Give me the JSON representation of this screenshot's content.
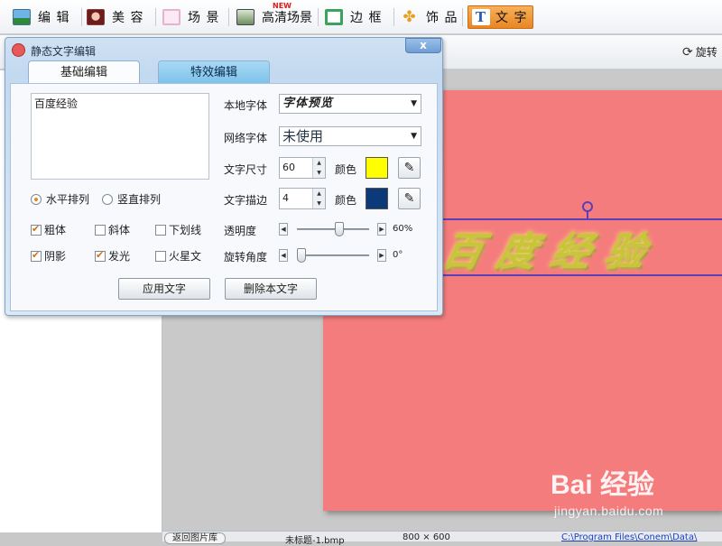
{
  "toolbar": {
    "items": [
      {
        "label": "编 辑",
        "icon": "landscape-photo-icon"
      },
      {
        "label": "美 容",
        "icon": "face-portrait-icon"
      },
      {
        "label": "场 景",
        "icon": "scene-frame-icon"
      },
      {
        "label": "高清场景",
        "icon": "hd-scene-icon",
        "badge": "NEW"
      },
      {
        "label": "边 框",
        "icon": "border-frame-icon"
      },
      {
        "label": "饰 品",
        "icon": "clover-ornament-icon"
      },
      {
        "label": "文 字",
        "icon": "text-t-icon",
        "active": true
      }
    ]
  },
  "subbar": {
    "rotate_label": "旋转"
  },
  "dialog": {
    "title": "静态文字编辑",
    "close_label": "x",
    "tabs": [
      "基础编辑",
      "特效编辑"
    ],
    "text_content": "百度经验",
    "layout": {
      "horizontal": "水平排列",
      "vertical": "竖直排列",
      "selected": "horizontal"
    },
    "styles": [
      {
        "label": "粗体",
        "checked": true
      },
      {
        "label": "斜体",
        "checked": false
      },
      {
        "label": "下划线",
        "checked": false
      },
      {
        "label": "阴影",
        "checked": true
      },
      {
        "label": "发光",
        "checked": true
      },
      {
        "label": "火星文",
        "checked": false
      }
    ],
    "local_font_label": "本地字体",
    "local_font_value": "字体预览",
    "net_font_label": "网络字体",
    "net_font_value": "未使用",
    "size_label": "文字尺寸",
    "size_value": "60",
    "color_label": "颜色",
    "text_color": "#ffff00",
    "stroke_label": "文字描边",
    "stroke_value": "4",
    "stroke_color": "#0c3a78",
    "opacity_label": "透明度",
    "opacity_value": "60%",
    "opacity_fraction": 0.6,
    "rotation_label": "旋转角度",
    "rotation_value": "0°",
    "rotation_fraction": 0.0,
    "apply_button": "应用文字",
    "delete_button": "删除本文字"
  },
  "canvas": {
    "photo_color": "#f47c7c",
    "art_text": "百度经验"
  },
  "statusbar": {
    "back_button": "返回图片库",
    "filename": "未标题-1.bmp",
    "dimensions": "800 × 600",
    "path": "C:\\Program Files\\Conem\\Data\\"
  },
  "watermark": {
    "logo": "Bai 经验",
    "sub": "jingyan.baidu.com"
  }
}
